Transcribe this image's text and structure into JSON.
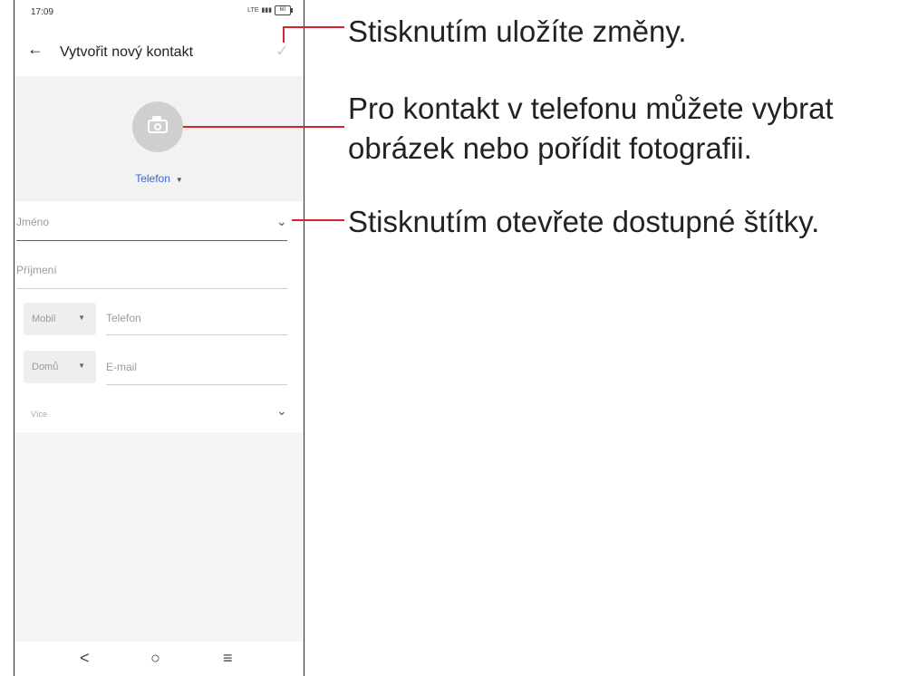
{
  "status_bar": {
    "time": "17:09",
    "network": "LTE",
    "battery": "60"
  },
  "app_bar": {
    "title": "Vytvořit nový kontakt"
  },
  "photo": {
    "account_label": "Telefon"
  },
  "form": {
    "first_name_placeholder": "Jméno",
    "last_name_placeholder": "Příjmení",
    "phone_type": "Mobil",
    "phone_placeholder": "Telefon",
    "email_type": "Domů",
    "email_placeholder": "E-mail",
    "more_label": "Více"
  },
  "nav": {
    "back": "<",
    "home": "○",
    "recents": "≡"
  },
  "callouts": {
    "save": "Stisknutím uložíte změny.",
    "photo_line1": "Pro kontakt v telefonu můžete vybrat",
    "photo_line2": "obrázek nebo pořídit fotografii.",
    "labels": "Stisknutím otevřete dostupné štítky."
  },
  "colors": {
    "accent": "#3a63d8",
    "callout": "#d9232b",
    "check_disabled": "#c9cde6"
  }
}
